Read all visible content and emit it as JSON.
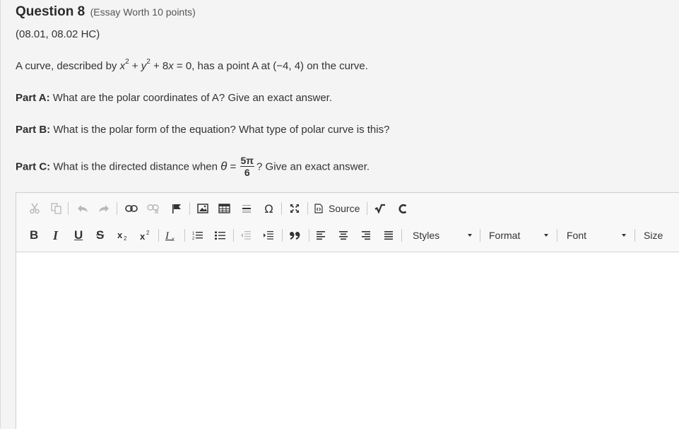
{
  "question": {
    "title": "Question 8",
    "worth": "(Essay Worth 10 points)",
    "codes": "(08.01, 08.02 HC)"
  },
  "prompt": {
    "intro_before": "A curve, described by ",
    "x_var": "x",
    "exp2": "2",
    "plus1": " + ",
    "y_var": "y",
    "exp2b": "2",
    "rest": " + 8",
    "x_var2": "x",
    "after": " = 0, has a point A at (−4, 4) on the curve.",
    "partA_label": "Part A:",
    "partA_text": " What are the polar coordinates of A? Give an exact answer.",
    "partB_label": "Part B:",
    "partB_text": " What is the polar form of the equation? What type of polar curve is this?",
    "partC_label": "Part C:",
    "partC_text": " What is the directed distance when ",
    "theta": "θ",
    "equals": " = ",
    "frac_num": "5π",
    "frac_den": "6",
    "partC_end": "? Give an exact answer."
  },
  "editor": {
    "toolbar": {
      "source_label": "Source",
      "bold": "B",
      "italic": "I",
      "underline": "U",
      "strike": "S",
      "styles_label": "Styles",
      "format_label": "Format",
      "font_label": "Font",
      "size_label": "Size"
    },
    "content": ""
  }
}
